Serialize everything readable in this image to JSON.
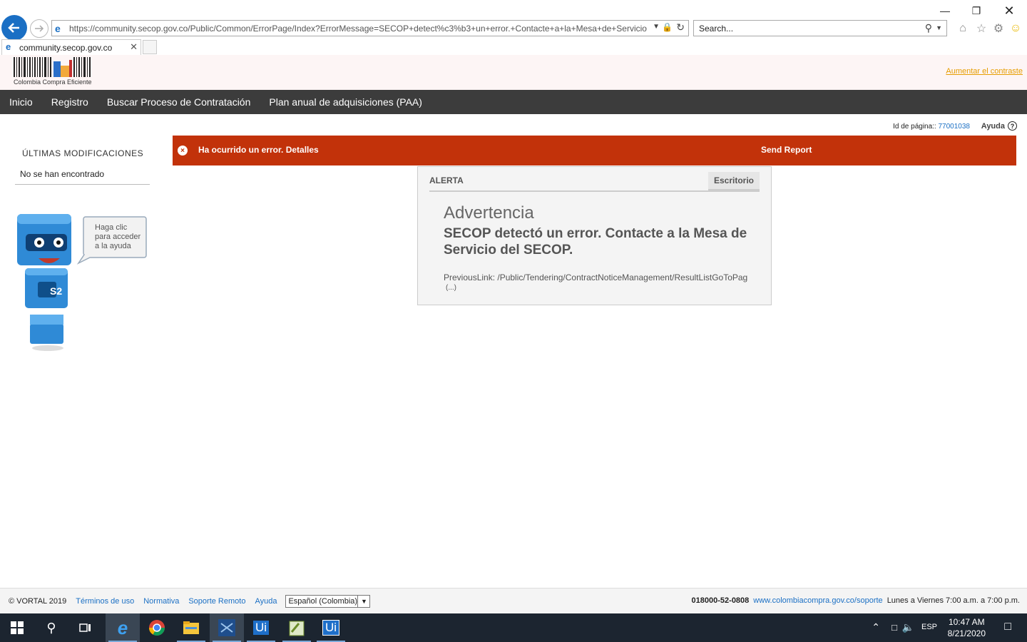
{
  "browser": {
    "url": "https://community.secop.gov.co/Public/Common/ErrorPage/Index?ErrorMessage=SECOP+detect%c3%b3+un+error.+Contacte+a+la+Mesa+de+Servicio",
    "search_placeholder": "Search...",
    "tab_title": "community.secop.gov.co"
  },
  "header": {
    "logo_text": "Colombia Compra Eficiente",
    "contrast_link": "Aumentar el contraste"
  },
  "nav": {
    "items": [
      "Inicio",
      "Registro",
      "Buscar Proceso de Contratación",
      "Plan anual de adquisiciones (PAA)"
    ]
  },
  "page_meta": {
    "page_id_label": "Id de página::",
    "page_id_value": "77001038",
    "help_label": "Ayuda",
    "help_icon": "?"
  },
  "sidebar": {
    "title": "ÚLTIMAS MODIFICACIONES",
    "empty": "No se han encontrado",
    "mascot_bubble": "Haga clic para acceder a la ayuda",
    "mascot_badge": "S2"
  },
  "error_bar": {
    "close_icon": "×",
    "message": "Ha ocurrido un error. Detalles",
    "send_report": "Send Report"
  },
  "alert": {
    "header": "ALERTA",
    "tab": "Escritorio",
    "warning_title": "Advertencia",
    "message": "SECOP detectó un error. Contacte a la Mesa de Servicio del SECOP.",
    "previous_link": "PreviousLink: /Public/Tendering/ContractNoticeManagement/ResultListGoToPag",
    "more": "(...)"
  },
  "footer": {
    "copyright": "© VORTAL 2019",
    "links": [
      "Términos de uso",
      "Normativa",
      "Soporte Remoto",
      "Ayuda"
    ],
    "language": "Español (Colombia)",
    "phone": "018000-52-0808",
    "support_site": "www.colombiacompra.gov.co/soporte",
    "hours": "Lunes a Viernes 7:00 a.m. a 7:00 p.m."
  },
  "taskbar": {
    "time": "10:47 AM",
    "date": "8/21/2020",
    "language": "ESP",
    "ui_icon_label": "Ui"
  },
  "colors": {
    "error_bar": "#c2320a",
    "navbar": "#3c3c3c",
    "link": "#1a6fc4",
    "contrast_link": "#e69d00"
  }
}
